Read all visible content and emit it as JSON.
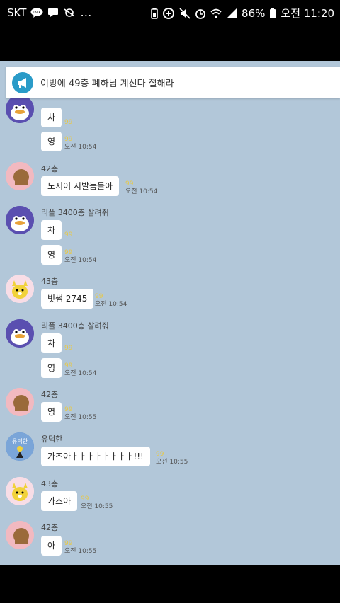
{
  "status": {
    "carrier": "SKT",
    "battery": "86%",
    "time": "오전 11:20"
  },
  "notice": {
    "text": "이방에 49층 폐하님 계신다 절해라"
  },
  "messages": [
    {
      "sender": "",
      "avatar": "duck",
      "bubble": "차",
      "read": "99",
      "time": ""
    },
    {
      "sender": "",
      "avatar": "",
      "bubble": "영",
      "read": "99",
      "time": "오전 10:54"
    },
    {
      "sender": "42층",
      "avatar": "bear",
      "bubble": "노저어 시발놈들아",
      "read": "99",
      "time": "오전 10:54"
    },
    {
      "sender": "리플 3400층 살려줘",
      "avatar": "duck",
      "bubble": "차",
      "read": "99",
      "time": ""
    },
    {
      "sender": "",
      "avatar": "",
      "bubble": "영",
      "read": "99",
      "time": "오전 10:54"
    },
    {
      "sender": "43층",
      "avatar": "muzi",
      "bubble": "빗썸 2745",
      "read": "99",
      "time": "오전 10:54"
    },
    {
      "sender": "리플 3400층 살려줘",
      "avatar": "duck",
      "bubble": "차",
      "read": "99",
      "time": ""
    },
    {
      "sender": "",
      "avatar": "",
      "bubble": "영",
      "read": "99",
      "time": "오전 10:54"
    },
    {
      "sender": "42층",
      "avatar": "bear",
      "bubble": "영",
      "read": "99",
      "time": "오전 10:55"
    },
    {
      "sender": "유덕한",
      "avatar": "blue",
      "avatar_text": "유덕한",
      "bubble": "가즈아ㅏㅏㅏㅏㅏㅏㅏㅏ!!!",
      "read": "99",
      "time": "오전 10:55"
    },
    {
      "sender": "43층",
      "avatar": "muzi",
      "bubble": "가즈아",
      "read": "99",
      "time": "오전 10:55"
    },
    {
      "sender": "42층",
      "avatar": "bear",
      "bubble": "아",
      "read": "99",
      "time": "오전 10:55"
    }
  ],
  "colors": {
    "chat_bg": "#b2c7d9",
    "read_count": "#e6c84b"
  }
}
